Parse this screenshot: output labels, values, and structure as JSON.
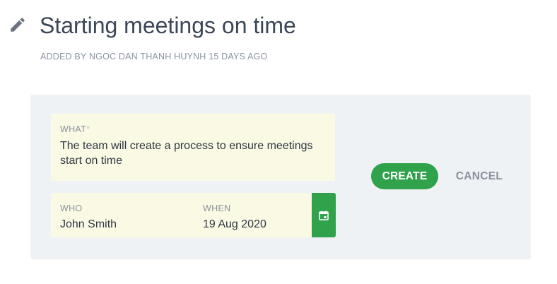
{
  "header": {
    "title": "Starting meetings on time",
    "meta": "ADDED BY NGOC DAN THANH HUYNH 15 DAYS AGO",
    "edit_icon": "pencil-icon"
  },
  "form": {
    "what": {
      "label": "WHAT",
      "required_marker": "*",
      "value": "The team will create a process to ensure meetings start on time"
    },
    "who": {
      "label": "WHO",
      "value": "John Smith"
    },
    "when": {
      "label": "WHEN",
      "value": "19 Aug 2020"
    },
    "calendar_icon": "calendar-icon",
    "create_label": "CREATE",
    "cancel_label": "CANCEL"
  },
  "colors": {
    "accent_green": "#30a24b",
    "field_background": "#f9f9e4",
    "panel_background": "#eff2f5",
    "muted_text": "#8a93a0"
  }
}
